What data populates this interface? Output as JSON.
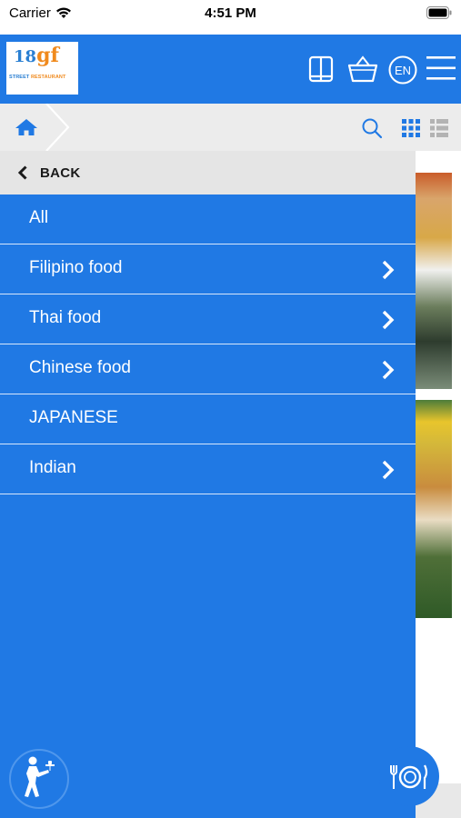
{
  "status_bar": {
    "carrier": "Carrier",
    "time": "4:51 PM"
  },
  "header": {
    "logo_mark": "gf",
    "logo_num": "18",
    "logo_text_blue": "STREET",
    "logo_text_orange": "RESTAURANT",
    "language": "EN"
  },
  "drawer": {
    "back_label": "BACK",
    "items": [
      {
        "label": "All",
        "has_children": false
      },
      {
        "label": "Filipino food",
        "has_children": true
      },
      {
        "label": "Thai food",
        "has_children": true
      },
      {
        "label": "Chinese food",
        "has_children": true
      },
      {
        "label": "JAPANESE",
        "has_children": false
      },
      {
        "label": "Indian",
        "has_children": true
      }
    ]
  },
  "icons": {
    "status": [
      "wifi-icon",
      "battery-icon"
    ],
    "header": [
      "book-icon",
      "basket-icon",
      "language-icon",
      "menu-icon"
    ],
    "crumb": [
      "home-icon",
      "search-icon",
      "grid-view-icon",
      "list-view-icon"
    ],
    "drawer": [
      "back-arrow-icon",
      "chevron-right-icon"
    ],
    "floating": [
      "waiter-icon",
      "dish-icon"
    ]
  },
  "colors": {
    "primary": "#2079e4",
    "crumb_bar": "#ececec",
    "back_bar": "#e5e5e5",
    "divider": "#d7e6fb",
    "logo_orange": "#f08a1d",
    "logo_blue": "#2a7fd2"
  }
}
